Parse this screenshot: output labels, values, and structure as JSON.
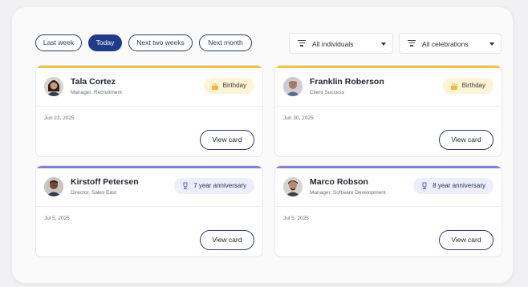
{
  "filters": {
    "range_pills": [
      "Last week",
      "Today",
      "Next two weeks",
      "Next month"
    ],
    "active_pill": "Today",
    "individuals": "All individuals",
    "celebrations": "All celebrations"
  },
  "cards": [
    {
      "name": "Tala Cortez",
      "role": "Manager, Recruitment",
      "badge": "Birthday",
      "badge_type": "birthday",
      "date": "Jun 23, 2025",
      "button": "View card"
    },
    {
      "name": "Franklin Roberson",
      "role": "Client Success",
      "badge": "Birthday",
      "badge_type": "birthday",
      "date": "Jun 30, 2025",
      "button": "View card"
    },
    {
      "name": "Kirstoff Petersen",
      "role": "Director, Sales East",
      "badge": "7 year anniversary",
      "badge_type": "anniversary",
      "date": "Jul 5, 2025",
      "button": "View card"
    },
    {
      "name": "Marco Robson",
      "role": "Manager, Software Development",
      "badge": "8 year anniversary",
      "badge_type": "anniversary",
      "date": "Jul 5, 2025",
      "button": "View card"
    }
  ],
  "colors": {
    "birthday_accent": "#f2c040",
    "anniversary_accent": "#7b82d6",
    "primary": "#1f3b8a"
  }
}
